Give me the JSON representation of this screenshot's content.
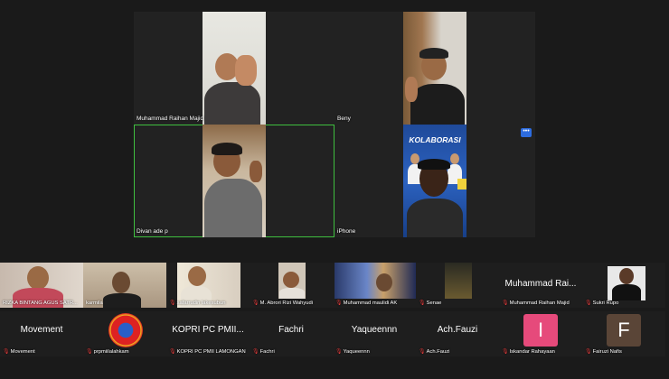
{
  "main_tiles": [
    {
      "name": "Muhammad Raihan Majid"
    },
    {
      "name": "Beny"
    },
    {
      "name": "Divan ade p"
    },
    {
      "name": "iPhone"
    }
  ],
  "poster_text": "KOLABORASI",
  "row1": [
    {
      "name": "RIZKA BINTANG AGUS SATR..."
    },
    {
      "name": "karmila"
    },
    {
      "name": "safarrudin lakesubun"
    },
    {
      "name": "M. Abrori Rizi Wahyudi"
    },
    {
      "name": "Muhammad maulidi AK"
    },
    {
      "name": "Senae"
    },
    {
      "name": "Muhammad Raihan Majid",
      "big": "Muhammad Rai..."
    },
    {
      "name": "Sukri Rupo"
    }
  ],
  "row2": [
    {
      "name": "Movement",
      "big": "Movement"
    },
    {
      "name": "prpmiilalahkam"
    },
    {
      "name": "KOPRI PC PMII LAMONGAN",
      "big": "KOPRI PC PMII..."
    },
    {
      "name": "Fachri",
      "big": "Fachri"
    },
    {
      "name": "Yaqueennn",
      "big": "Yaqueennn"
    },
    {
      "name": "Ach.Fauzi",
      "big": "Ach.Fauzi"
    },
    {
      "name": "Iskandar Rahayaan",
      "initial": "I"
    },
    {
      "name": "Fairuzi Nafis",
      "initial": "F"
    }
  ],
  "colors": {
    "active_border": "#3fbf3f",
    "initial_pink": "#e64a7b",
    "initial_brown": "#5a4537",
    "mic_muted": "#e03b3b"
  }
}
